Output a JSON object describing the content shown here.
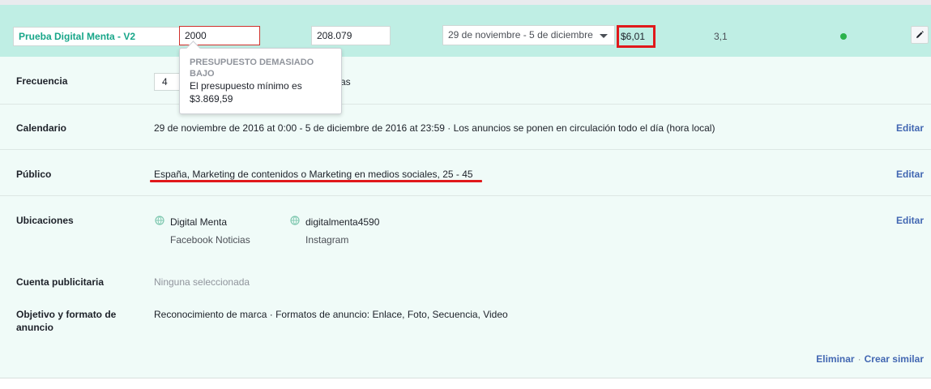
{
  "header": {
    "name": "Prueba Digital Menta - V2",
    "budget": "2000",
    "impressions": "208.079",
    "date_range": "29 de noviembre - 5 de diciembre",
    "cost": "$6,01",
    "metric": "3,1",
    "status_color": "#2bb24c"
  },
  "tooltip": {
    "title": "PRESUPUESTO DEMASIADO BAJO",
    "body": "El presupuesto mínimo es $3.869,59"
  },
  "rows": {
    "frecuencia": {
      "label": "Frecuencia",
      "value": "4",
      "suffix": "as"
    },
    "calendario": {
      "label": "Calendario",
      "value": "29 de noviembre de 2016 at 0:00 - 5 de diciembre de 2016 at 23:59 · Los anuncios se ponen en circulación todo el día (hora local)",
      "edit": "Editar"
    },
    "publico": {
      "label": "Público",
      "value": "España, Marketing de contenidos o Marketing en medios sociales, 25 - 45",
      "edit": "Editar"
    },
    "ubicaciones": {
      "label": "Ubicaciones",
      "edit": "Editar",
      "places": [
        {
          "name": "Digital Menta",
          "channel": "Facebook Noticias",
          "icon": "globe-icon"
        },
        {
          "name": "digitalmenta4590",
          "channel": "Instagram",
          "icon": "globe-icon"
        }
      ]
    },
    "cuenta": {
      "label": "Cuenta publicitaria",
      "value": "Ninguna seleccionada"
    },
    "objetivo": {
      "label_line1": "Objetivo y formato de",
      "label_line2": "anuncio",
      "value": "Reconocimiento de marca · Formatos de anuncio: Enlace, Foto, Secuencia, Video"
    }
  },
  "footer": {
    "delete": "Eliminar",
    "separator": "·",
    "duplicate": "Crear similar"
  }
}
